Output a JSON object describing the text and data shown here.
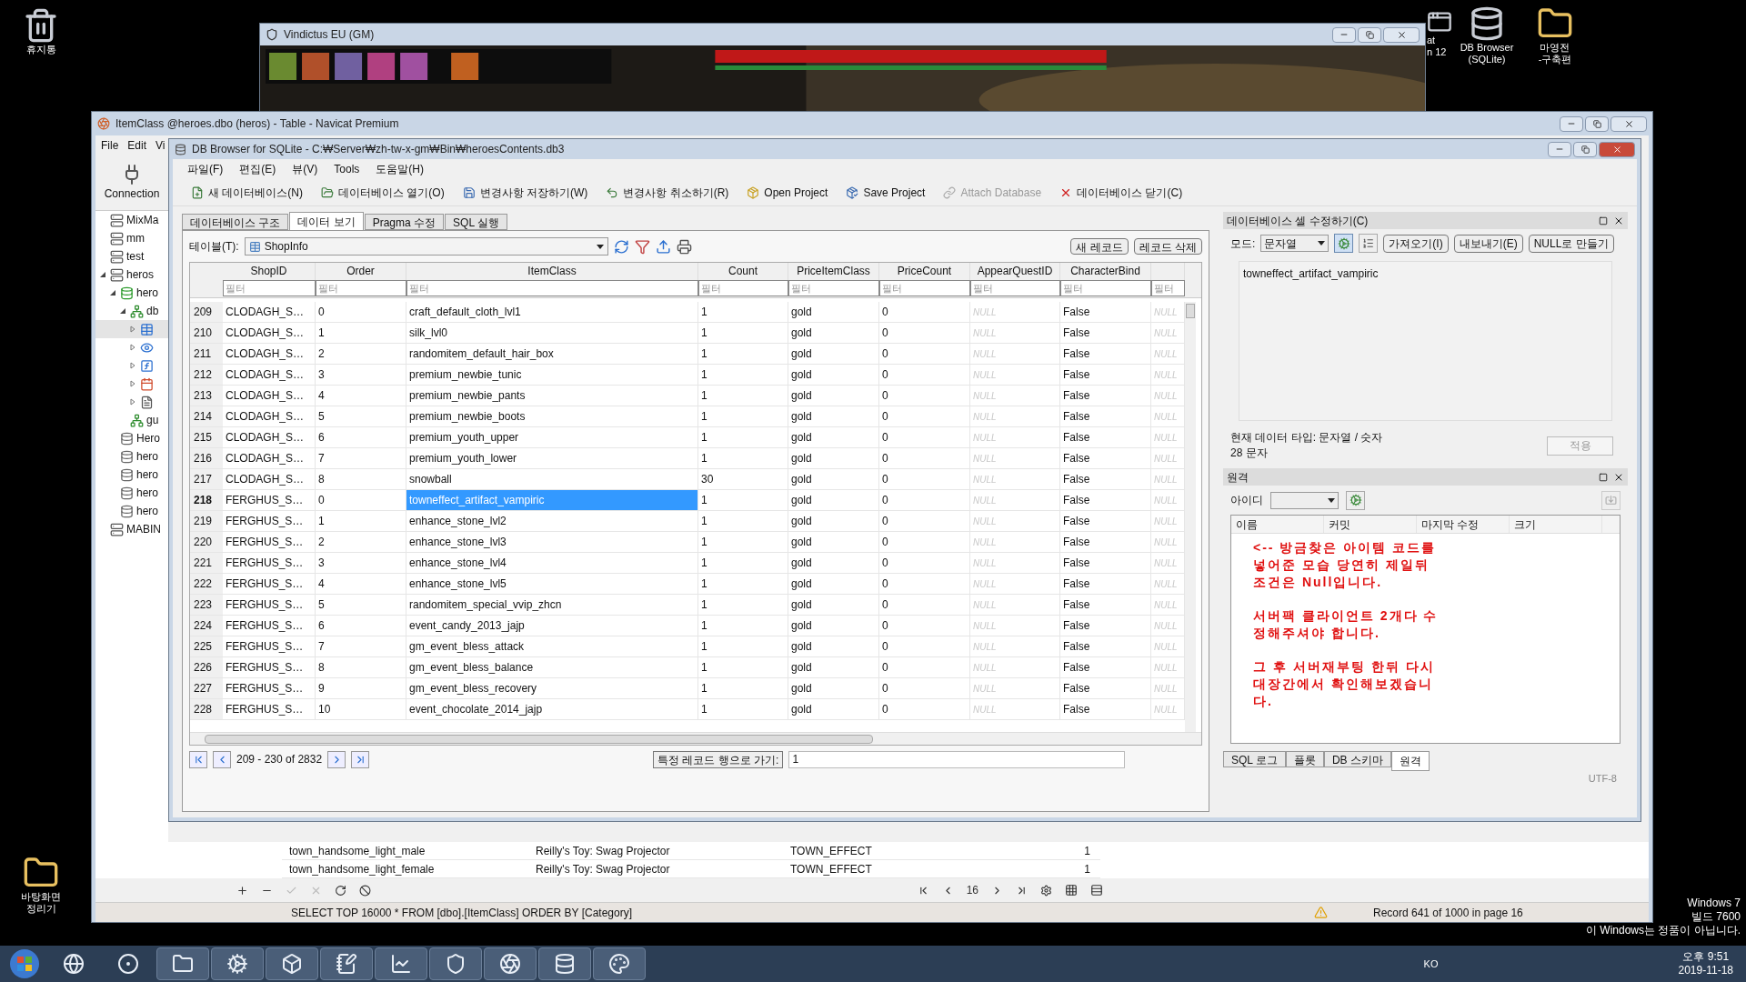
{
  "desktop": {
    "icons": [
      {
        "lines": [
          "휴지통"
        ],
        "kind": "bin"
      },
      {
        "lines": [
          "바탕화면",
          "정리기"
        ],
        "kind": "folder"
      },
      {
        "lines": [
          "at",
          "n 12"
        ],
        "kind": "app"
      },
      {
        "lines": [
          "DB Browser",
          "(SQLite)"
        ],
        "kind": "database"
      },
      {
        "lines": [
          "마영전",
          "-구축편"
        ],
        "kind": "folder"
      }
    ]
  },
  "game_window": {
    "title": "Vindictus EU (GM)"
  },
  "navicat": {
    "title": "ItemClass @heroes.dbo (heros) - Table - Navicat Premium",
    "menu": [
      "File",
      "Edit",
      "Vi"
    ],
    "toolbar": [
      "Connection"
    ],
    "tree": [
      {
        "label": "MixMa",
        "kind": "server",
        "selected": false
      },
      {
        "label": "mm",
        "kind": "server",
        "selected": false
      },
      {
        "label": "test",
        "kind": "server",
        "selected": false
      },
      {
        "label": "heros",
        "kind": "server",
        "selected": false,
        "expanded": true,
        "children": [
          {
            "label": "hero",
            "kind": "db-open",
            "selected": false,
            "expanded": true,
            "children": [
              {
                "label": "db",
                "kind": "schema",
                "selected": false,
                "expanded": true,
                "children": [
                  {
                    "kind": "tables",
                    "selected": true,
                    "expanded": false
                  },
                  {
                    "kind": "views",
                    "selected": false,
                    "expanded": false
                  },
                  {
                    "kind": "functions",
                    "selected": false,
                    "expanded": false
                  },
                  {
                    "kind": "events",
                    "selected": false,
                    "expanded": false
                  },
                  {
                    "kind": "reports",
                    "selected": false,
                    "expanded": false
                  }
                ]
              },
              {
                "label": "gu",
                "kind": "schema",
                "selected": false
              }
            ]
          },
          {
            "label": "Hero",
            "kind": "db",
            "selected": false
          },
          {
            "label": "hero",
            "kind": "db",
            "selected": false
          },
          {
            "label": "hero",
            "kind": "db",
            "selected": false
          },
          {
            "label": "hero",
            "kind": "db",
            "selected": false
          },
          {
            "label": "hero",
            "kind": "db",
            "selected": false
          }
        ]
      },
      {
        "label": "MABIN",
        "kind": "server",
        "selected": false
      }
    ],
    "rows": [
      [
        "town_handsome_light_male",
        "Reilly's Toy: Swag Projector",
        "TOWN_EFFECT",
        "1"
      ],
      [
        "town_handsome_light_female",
        "Reilly's Toy: Swag Projector",
        "TOWN_EFFECT",
        "1"
      ]
    ],
    "page": "16",
    "status": "SELECT TOP 16000 * FROM [dbo].[ItemClass] ORDER BY [Category]",
    "record": "Record 641 of 1000 in page 16"
  },
  "dbbrowser": {
    "title": "DB Browser for SQLite - C:₩Server₩zh-tw-x-gm₩Bin₩heroesContents.db3",
    "menu": [
      "파일(F)",
      "편집(E)",
      "뷰(V)",
      "Tools",
      "도움말(H)"
    ],
    "toolbar": [
      {
        "label": "새 데이터베이스(N)",
        "kind": "new",
        "disabled": false
      },
      {
        "label": "데이터베이스 열기(O)",
        "kind": "open",
        "disabled": false
      },
      {
        "label": "변경사항 저장하기(W)",
        "kind": "save",
        "disabled": false
      },
      {
        "label": "변경사항 취소하기(R)",
        "kind": "revert",
        "disabled": false
      },
      {
        "label": "Open Project",
        "kind": "project-open",
        "disabled": false
      },
      {
        "label": "Save Project",
        "kind": "project-save",
        "disabled": false
      },
      {
        "label": "Attach Database",
        "kind": "attach",
        "disabled": true
      },
      {
        "label": "데이터베이스 닫기(C)",
        "kind": "close",
        "disabled": false
      }
    ],
    "tabs": [
      {
        "label": "데이터베이스 구조",
        "selected": false
      },
      {
        "label": "데이터 보기",
        "selected": true
      },
      {
        "label": "Pragma 수정",
        "selected": false
      },
      {
        "label": "SQL 실행",
        "selected": false
      }
    ],
    "table_label": "테이블(T):",
    "table_select": "ShopInfo",
    "record_buttons": [
      "새 레코드",
      "레코드 삭제"
    ],
    "columns": [
      {
        "label": "ShopID",
        "kind": "text",
        "placeholder": "필터"
      },
      {
        "label": "Order",
        "kind": "text",
        "placeholder": "필터"
      },
      {
        "label": "ItemClass",
        "kind": "text",
        "placeholder": "필터"
      },
      {
        "label": "Count",
        "kind": "text",
        "placeholder": "필터"
      },
      {
        "label": "PriceItemClass",
        "kind": "text",
        "placeholder": "필터"
      },
      {
        "label": "PriceCount",
        "kind": "text",
        "placeholder": "필터"
      },
      {
        "label": "AppearQuestID",
        "kind": "null",
        "placeholder": "필터"
      },
      {
        "label": "CharacterBind",
        "kind": "text",
        "placeholder": "필터"
      },
      {
        "kind": "null",
        "placeholder": "필터"
      }
    ],
    "rows": [
      {
        "num": "209",
        "selected": false,
        "cells": [
          "CLODAGH_S…",
          "0",
          "craft_default_cloth_lvl1",
          "1",
          "gold",
          "0",
          "NULL",
          "False",
          "NULL"
        ]
      },
      {
        "num": "210",
        "selected": false,
        "cells": [
          "CLODAGH_S…",
          "1",
          "silk_lvl0",
          "1",
          "gold",
          "0",
          "NULL",
          "False",
          "NULL"
        ]
      },
      {
        "num": "211",
        "selected": false,
        "cells": [
          "CLODAGH_S…",
          "2",
          "randomitem_default_hair_box",
          "1",
          "gold",
          "0",
          "NULL",
          "False",
          "NULL"
        ]
      },
      {
        "num": "212",
        "selected": false,
        "cells": [
          "CLODAGH_S…",
          "3",
          "premium_newbie_tunic",
          "1",
          "gold",
          "0",
          "NULL",
          "False",
          "NULL"
        ]
      },
      {
        "num": "213",
        "selected": false,
        "cells": [
          "CLODAGH_S…",
          "4",
          "premium_newbie_pants",
          "1",
          "gold",
          "0",
          "NULL",
          "False",
          "NULL"
        ]
      },
      {
        "num": "214",
        "selected": false,
        "cells": [
          "CLODAGH_S…",
          "5",
          "premium_newbie_boots",
          "1",
          "gold",
          "0",
          "NULL",
          "False",
          "NULL"
        ]
      },
      {
        "num": "215",
        "selected": false,
        "cells": [
          "CLODAGH_S…",
          "6",
          "premium_youth_upper",
          "1",
          "gold",
          "0",
          "NULL",
          "False",
          "NULL"
        ]
      },
      {
        "num": "216",
        "selected": false,
        "cells": [
          "CLODAGH_S…",
          "7",
          "premium_youth_lower",
          "1",
          "gold",
          "0",
          "NULL",
          "False",
          "NULL"
        ]
      },
      {
        "num": "217",
        "selected": false,
        "cells": [
          "CLODAGH_S…",
          "8",
          "snowball",
          "30",
          "gold",
          "0",
          "NULL",
          "False",
          "NULL"
        ]
      },
      {
        "num": "218",
        "selected": true,
        "cells": [
          "FERGHUS_S…",
          "0",
          "towneffect_artifact_vampiric",
          "1",
          "gold",
          "0",
          "NULL",
          "False",
          "NULL"
        ]
      },
      {
        "num": "219",
        "selected": false,
        "cells": [
          "FERGHUS_S…",
          "1",
          "enhance_stone_lvl2",
          "1",
          "gold",
          "0",
          "NULL",
          "False",
          "NULL"
        ]
      },
      {
        "num": "220",
        "selected": false,
        "cells": [
          "FERGHUS_S…",
          "2",
          "enhance_stone_lvl3",
          "1",
          "gold",
          "0",
          "NULL",
          "False",
          "NULL"
        ]
      },
      {
        "num": "221",
        "selected": false,
        "cells": [
          "FERGHUS_S…",
          "3",
          "enhance_stone_lvl4",
          "1",
          "gold",
          "0",
          "NULL",
          "False",
          "NULL"
        ]
      },
      {
        "num": "222",
        "selected": false,
        "cells": [
          "FERGHUS_S…",
          "4",
          "enhance_stone_lvl5",
          "1",
          "gold",
          "0",
          "NULL",
          "False",
          "NULL"
        ]
      },
      {
        "num": "223",
        "selected": false,
        "cells": [
          "FERGHUS_S…",
          "5",
          "randomitem_special_vvip_zhcn",
          "1",
          "gold",
          "0",
          "NULL",
          "False",
          "NULL"
        ]
      },
      {
        "num": "224",
        "selected": false,
        "cells": [
          "FERGHUS_S…",
          "6",
          "event_candy_2013_jajp",
          "1",
          "gold",
          "0",
          "NULL",
          "False",
          "NULL"
        ]
      },
      {
        "num": "225",
        "selected": false,
        "cells": [
          "FERGHUS_S…",
          "7",
          "gm_event_bless_attack",
          "1",
          "gold",
          "0",
          "NULL",
          "False",
          "NULL"
        ]
      },
      {
        "num": "226",
        "selected": false,
        "cells": [
          "FERGHUS_S…",
          "8",
          "gm_event_bless_balance",
          "1",
          "gold",
          "0",
          "NULL",
          "False",
          "NULL"
        ]
      },
      {
        "num": "227",
        "selected": false,
        "cells": [
          "FERGHUS_S…",
          "9",
          "gm_event_bless_recovery",
          "1",
          "gold",
          "0",
          "NULL",
          "False",
          "NULL"
        ]
      },
      {
        "num": "228",
        "selected": false,
        "cells": [
          "FERGHUS_S…",
          "10",
          "event_chocolate_2014_jajp",
          "1",
          "gold",
          "0",
          "NULL",
          "False",
          "NULL"
        ]
      }
    ],
    "pager": {
      "range": "209 - 230 of 2832",
      "goto_label": "특정 레코드 행으로 가기:",
      "goto_value": "1"
    },
    "edit_cell": {
      "title": "데이터베이스 셀 수정하기(C)",
      "mode_label": "모드:",
      "mode": "문자열",
      "buttons": [
        "가져오기(I)",
        "내보내기(E)",
        "NULL로 만들기"
      ],
      "value": "towneffect_artifact_vampiric",
      "type_info": "현재 데이터 타입: 문자열 / 숫자",
      "size_info": "28 문자",
      "apply": {
        "label": "적용",
        "disabled": true
      }
    },
    "remote": {
      "title": "원격",
      "id_label": "아이디",
      "columns": [
        "이름",
        "커밋",
        "마지막 수정",
        "크기"
      ],
      "note": [
        "<-- 방금찾은 아이템 코드를 넣어준 모습 당연히 제일뒤 조건은 Null입니다.",
        "서버팩 클라이언트 2개다 수정해주셔야 합니다.",
        "그 후 서버재부팅 한뒤 다시 대장간에서 확인해보겠습니다."
      ]
    },
    "dock_tabs": [
      {
        "label": "SQL 로그",
        "selected": false
      },
      {
        "label": "플롯",
        "selected": false
      },
      {
        "label": "DB 스키마",
        "selected": false
      },
      {
        "label": "원격",
        "selected": true
      }
    ],
    "encoding": "UTF-8"
  },
  "os_notice": [
    "Windows 7",
    "빌드 7600",
    "이 Windows는 정품이 아닙니다."
  ],
  "taskbar": {
    "lang": "KO",
    "time": "오후 9:51",
    "date": "2019-11-18"
  }
}
